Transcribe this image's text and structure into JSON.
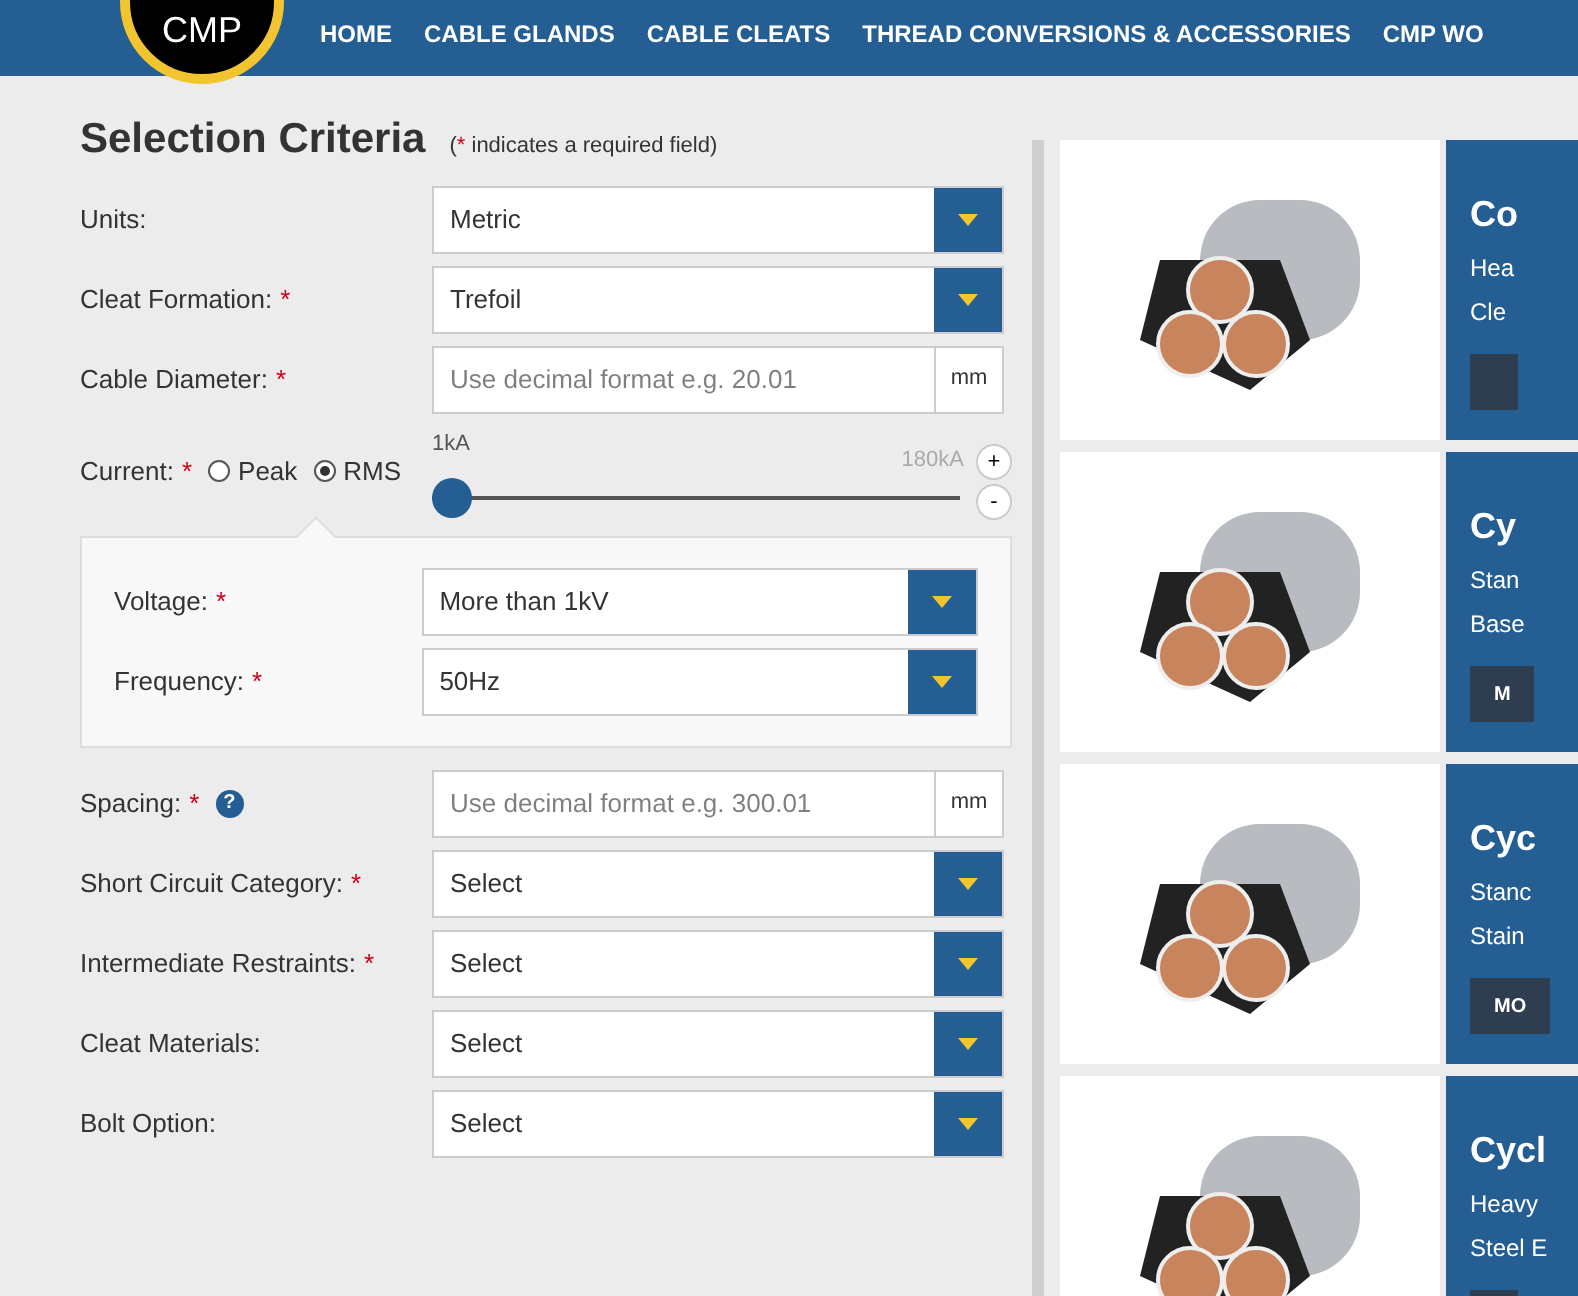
{
  "nav": {
    "logo": "CMP",
    "items": [
      {
        "label": "HOME"
      },
      {
        "label": "CABLE GLANDS"
      },
      {
        "label": "CABLE CLEATS"
      },
      {
        "label": "THREAD CONVERSIONS & ACCESSORIES"
      },
      {
        "label": "CMP WO"
      }
    ]
  },
  "form": {
    "title": "Selection Criteria",
    "note_open": "(",
    "note_mark": "*",
    "note_text": " indicates a required field)",
    "fields": [
      {
        "kind": "select",
        "label": "Units:",
        "required": false,
        "value": "Metric"
      },
      {
        "kind": "select",
        "label": "Cleat Formation:",
        "required": true,
        "value": "Trefoil"
      },
      {
        "kind": "input",
        "label": "Cable Diameter:",
        "required": true,
        "placeholder": "Use decimal format e.g. 20.01",
        "unit": "mm"
      },
      {
        "kind": "current",
        "label": "Current:",
        "required": true,
        "options": [
          {
            "label": "Peak",
            "selected": false
          },
          {
            "label": "RMS",
            "selected": true
          }
        ],
        "min": "1kA",
        "max": "180kA",
        "level": 0,
        "plus": "+",
        "minus": "-"
      },
      {
        "kind": "panel",
        "fields": [
          {
            "kind": "select",
            "label": "Voltage:",
            "required": true,
            "value": "More than 1kV"
          },
          {
            "kind": "select",
            "label": "Frequency:",
            "required": true,
            "value": "50Hz"
          }
        ]
      },
      {
        "kind": "input",
        "label": "Spacing:",
        "required": true,
        "help": "?",
        "placeholder": "Use decimal format e.g. 300.01",
        "unit": "mm"
      },
      {
        "kind": "select",
        "label": "Short Circuit Category:",
        "required": true,
        "value": "Select"
      },
      {
        "kind": "select",
        "label": "Intermediate Restraints:",
        "required": true,
        "value": "Select"
      },
      {
        "kind": "select",
        "label": "Cleat Materials:",
        "required": false,
        "value": "Select"
      },
      {
        "kind": "select",
        "label": "Bolt Option:",
        "required": false,
        "value": "Select"
      }
    ]
  },
  "products": [
    {
      "title": "Co",
      "lines": [
        "Hea",
        "Cle"
      ]
    },
    {
      "title": "Cy",
      "lines": [
        "Stan",
        "Base"
      ],
      "button": "M"
    },
    {
      "title": "Cyc",
      "lines": [
        "Stanc",
        "Stain"
      ],
      "button": "MO"
    },
    {
      "title": "Cycl",
      "lines": [
        "Heavy",
        "Steel E"
      ]
    }
  ]
}
